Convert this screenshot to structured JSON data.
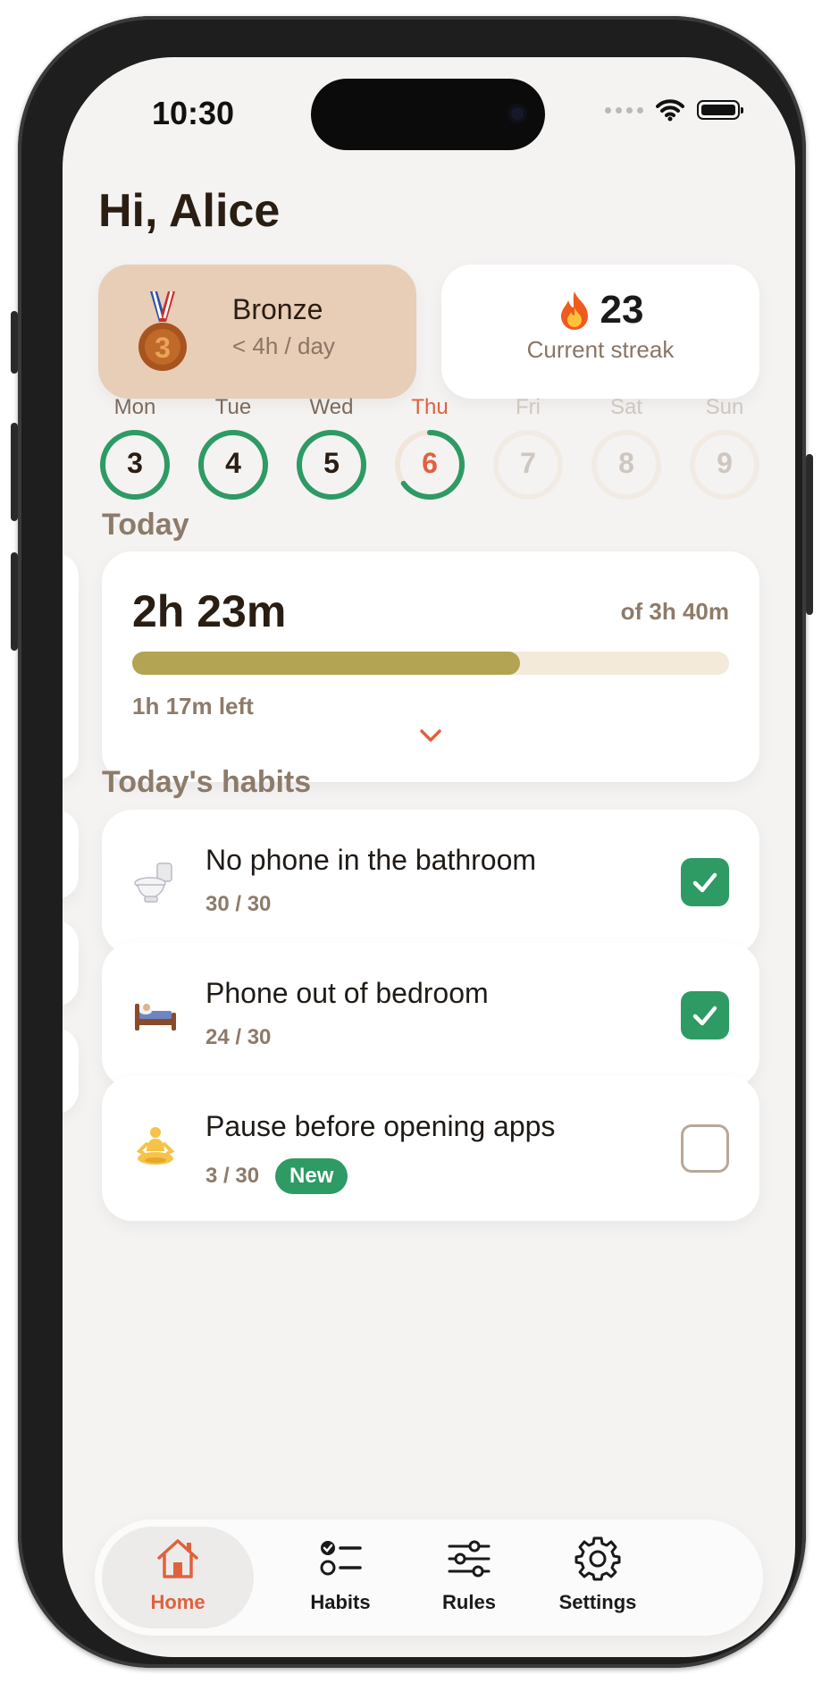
{
  "status_bar": {
    "time": "10:30"
  },
  "greeting": "Hi, Alice",
  "badge": {
    "title": "Bronze",
    "subtitle": "< 4h / day",
    "medal_number": "3"
  },
  "streak": {
    "value": "23",
    "label": "Current streak"
  },
  "week": [
    {
      "name": "Mon",
      "number": "3",
      "state": "complete"
    },
    {
      "name": "Tue",
      "number": "4",
      "state": "complete"
    },
    {
      "name": "Wed",
      "number": "5",
      "state": "complete"
    },
    {
      "name": "Thu",
      "number": "6",
      "state": "today",
      "progress": 0.65
    },
    {
      "name": "Fri",
      "number": "7",
      "state": "future"
    },
    {
      "name": "Sat",
      "number": "8",
      "state": "future"
    },
    {
      "name": "Sun",
      "number": "9",
      "state": "future"
    }
  ],
  "today": {
    "section_title": "Today",
    "time_used": "2h 23m",
    "goal": "of 3h 40m",
    "remaining": "1h 17m left",
    "progress": 0.65
  },
  "habits_section_title": "Today's habits",
  "habits": [
    {
      "icon": "toilet-icon",
      "name": "No phone in the bathroom",
      "count": "30 / 30",
      "checked": true,
      "badge": ""
    },
    {
      "icon": "bed-icon",
      "name": "Phone out of bedroom",
      "count": "24 / 30",
      "checked": true,
      "badge": ""
    },
    {
      "icon": "meditation-icon",
      "name": "Pause before opening apps",
      "count": "3 / 30",
      "checked": false,
      "badge": "New"
    }
  ],
  "tabs": [
    {
      "label": "Home",
      "icon": "home-icon",
      "active": true
    },
    {
      "label": "Habits",
      "icon": "habits-list-icon",
      "active": false
    },
    {
      "label": "Rules",
      "icon": "sliders-icon",
      "active": false
    },
    {
      "label": "Settings",
      "icon": "gear-icon",
      "active": false
    }
  ],
  "colors": {
    "accent": "#e0613d",
    "green": "#2e9a64",
    "progress": "#b3a453",
    "badge_bg": "#e8cdb7",
    "screen_bg": "#f4f3f2"
  }
}
